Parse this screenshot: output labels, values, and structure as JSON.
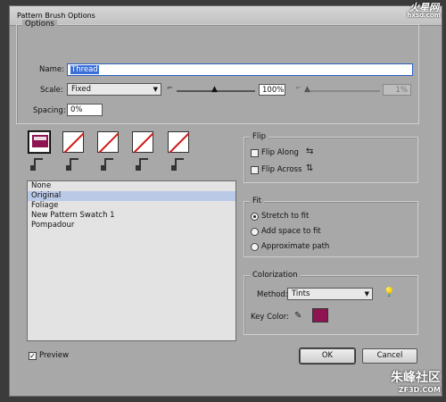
{
  "window": {
    "title": "Pattern Brush Options"
  },
  "watermarks": {
    "top_brand": "火星网",
    "top_site": "hxsd.com",
    "bottom_brand": "朱峰社区",
    "bottom_site": "ZF3D.COM"
  },
  "options": {
    "legend": "Options",
    "name_label": "Name:",
    "name_value": "Thread",
    "scale_label": "Scale:",
    "scale_method": "Fixed",
    "scale_percent": "100%",
    "scale_variation": "1%",
    "spacing_label": "Spacing:",
    "spacing_value": "0%"
  },
  "tiles": [
    {
      "name": "side-tile",
      "state": "swatch"
    },
    {
      "name": "outer-corner-tile",
      "state": "none"
    },
    {
      "name": "inner-corner-tile",
      "state": "none"
    },
    {
      "name": "start-tile",
      "state": "none"
    },
    {
      "name": "end-tile",
      "state": "none"
    }
  ],
  "swatch_list": [
    "None",
    "Original",
    "Foliage",
    "New Pattern Swatch 1",
    "Pompadour"
  ],
  "swatch_selected": "Original",
  "flip": {
    "legend": "Flip",
    "along": "Flip Along",
    "across": "Flip Across",
    "along_checked": false,
    "across_checked": false
  },
  "fit": {
    "legend": "Fit",
    "options": [
      "Stretch to fit",
      "Add space to fit",
      "Approximate path"
    ],
    "selected": "Stretch to fit"
  },
  "colorization": {
    "legend": "Colorization",
    "method_label": "Method:",
    "method_value": "Tints",
    "key_color_label": "Key Color:",
    "key_color": "#8e1452"
  },
  "preview": {
    "label": "Preview",
    "checked": true
  },
  "buttons": {
    "ok": "OK",
    "cancel": "Cancel"
  },
  "colors": {
    "dialog_bg": "#a8a8a8",
    "accent_selection": "#3a6fd6",
    "list_selection": "#b9c9e6",
    "no_tile_slash": "#d01c1c"
  }
}
